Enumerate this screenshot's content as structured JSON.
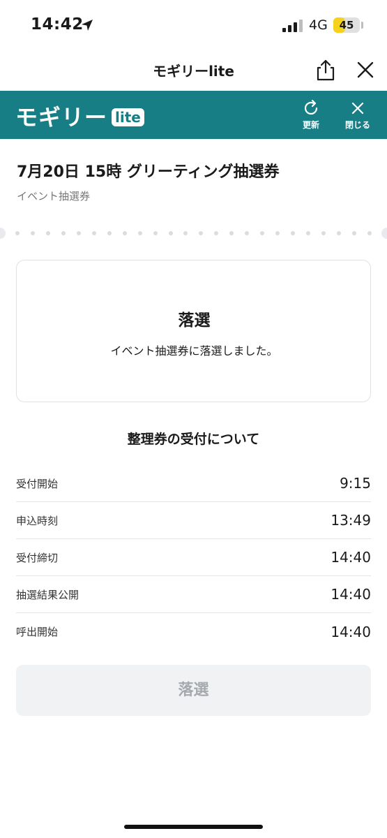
{
  "status_bar": {
    "time": "14:42",
    "network": "4G",
    "battery_level": 45,
    "battery_text": "45",
    "battery_color": "#f6d21a"
  },
  "browser": {
    "title": "モギリーlite",
    "share_icon": "share-icon",
    "close_icon": "close-icon"
  },
  "app_bar": {
    "background": "#177e85",
    "brand_text": "モギリー",
    "brand_badge": "lite",
    "refresh_label": "更新",
    "close_label": "閉じる"
  },
  "ticket": {
    "title": "7月20日 15時 グリーティング抽選券",
    "subtitle": "イベント抽選券"
  },
  "result": {
    "heading": "落選",
    "message": "イベント抽選券に落選しました。"
  },
  "info": {
    "heading": "整理券の受付について",
    "rows": [
      {
        "label": "受付開始",
        "value": "9:15"
      },
      {
        "label": "申込時刻",
        "value": "13:49"
      },
      {
        "label": "受付締切",
        "value": "14:40"
      },
      {
        "label": "抽選結果公開",
        "value": "14:40"
      },
      {
        "label": "呼出開始",
        "value": "14:40"
      }
    ]
  },
  "action_button": {
    "label": "落選",
    "disabled": true
  }
}
